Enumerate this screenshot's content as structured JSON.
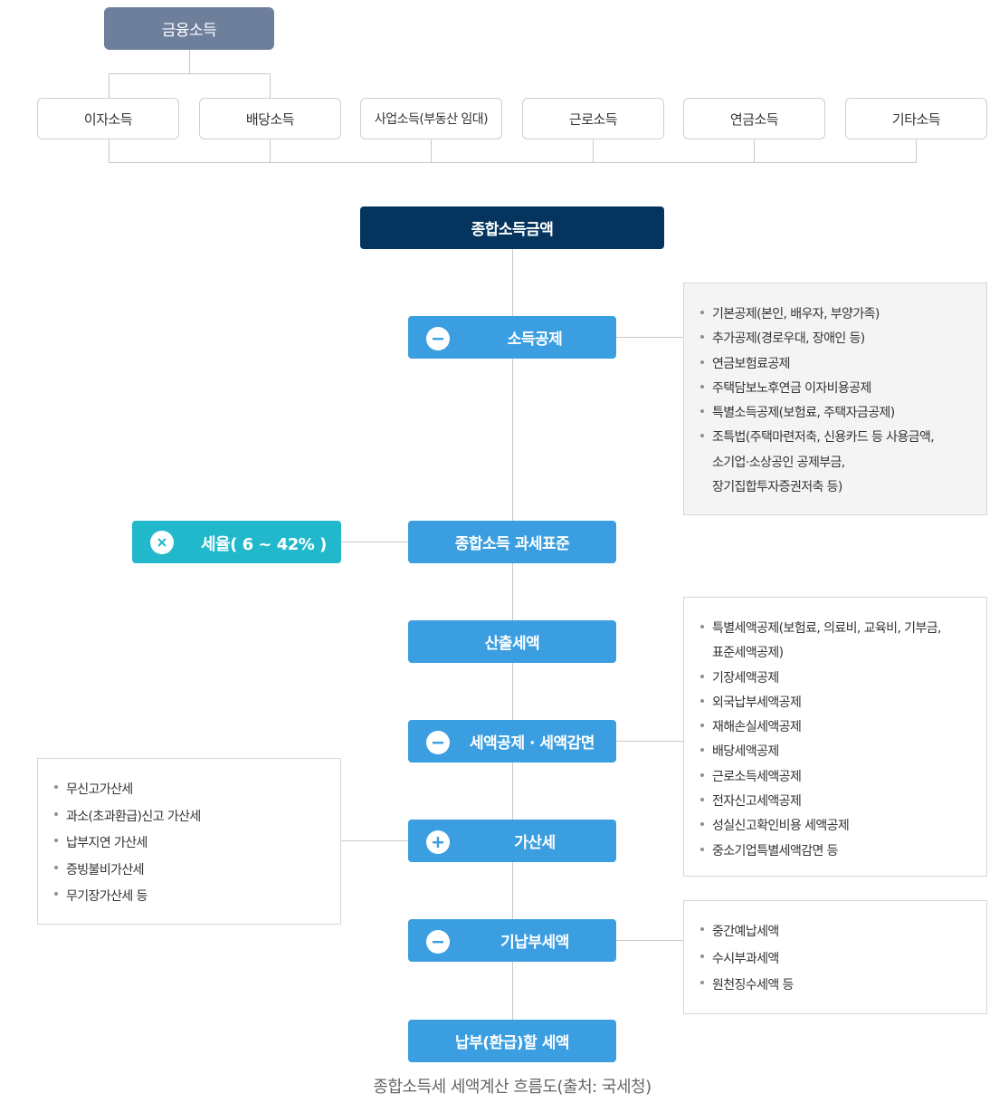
{
  "top": {
    "label": "금융소득"
  },
  "incomes": [
    "이자소득",
    "배당소득",
    "사업소득(부동산 임대)",
    "근로소득",
    "연금소득",
    "기타소득"
  ],
  "total": {
    "label": "종합소득금액"
  },
  "steps": {
    "deduction": "소득공제",
    "tax_base": "종합소득 과세표준",
    "computed_tax": "산출세액",
    "credits": "세액공제 · 세액감면",
    "penalty": "가산세",
    "prepaid": "기납부세액",
    "payable": "납부(환급)할 세액"
  },
  "rate": {
    "label": "세율( 6 ~ 42% )"
  },
  "operators": {
    "minus": "−",
    "times": "×",
    "plus": "+"
  },
  "notes": {
    "deduction": [
      "기본공제(본인, 배우자, 부양가족)",
      "추가공제(경로우대, 장애인 등)",
      "연금보험료공제",
      "주택담보노후연금 이자비용공제",
      "특별소득공제(보험료, 주택자금공제)",
      "조특법(주택마련저축, 신용카드 등 사용금액,",
      "소기업·소상공인 공제부금,",
      "장기집합투자증권저축 등)"
    ],
    "credits": [
      "특별세액공제(보험료, 의료비, 교육비, 기부금,",
      "표준세액공제)",
      "기장세액공제",
      "외국납부세액공제",
      "재해손실세액공제",
      "배당세액공제",
      "근로소득세액공제",
      "전자신고세액공제",
      "성실신고확인비용 세액공제",
      "중소기업특별세액감면 등"
    ],
    "penalty": [
      "무신고가산세",
      "과소(초과환급)신고 가산세",
      "납부지연 가산세",
      "증빙불비가산세",
      "무기장가산세 등"
    ],
    "prepaid": [
      "중간예납세액",
      "수시부과세액",
      "원천징수세액 등"
    ]
  },
  "caption": "종합소득세 세액계산 흐름도(출처: 국세청)"
}
